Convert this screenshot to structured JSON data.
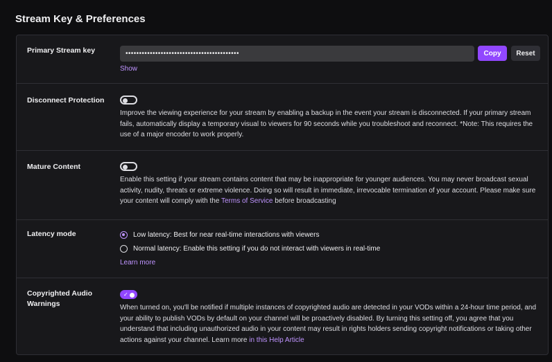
{
  "page": {
    "title": "Stream Key & Preferences"
  },
  "stream_key": {
    "label": "Primary Stream key",
    "masked_value": "••••••••••••••••••••••••••••••••••••••••••",
    "copy_label": "Copy",
    "reset_label": "Reset",
    "show_label": "Show"
  },
  "disconnect_protection": {
    "label": "Disconnect Protection",
    "enabled": false,
    "description": "Improve the viewing experience for your stream by enabling a backup in the event your stream is disconnected. If your primary stream fails, automatically display a temporary visual to viewers for 90 seconds while you troubleshoot and reconnect. *Note: This requires the use of a major encoder to work properly."
  },
  "mature_content": {
    "label": "Mature Content",
    "enabled": false,
    "description_before": "Enable this setting if your stream contains content that may be inappropriate for younger audiences. You may never broadcast sexual activity, nudity, threats or extreme violence. Doing so will result in immediate, irrevocable termination of your account. Please make sure your content will comply with the ",
    "link_label": "Terms of Service",
    "description_after": " before broadcasting"
  },
  "latency_mode": {
    "label": "Latency mode",
    "options": [
      {
        "label": "Low latency: Best for near real-time interactions with viewers",
        "selected": true
      },
      {
        "label": "Normal latency: Enable this setting if you do not interact with viewers in real-time",
        "selected": false
      }
    ],
    "learn_more_label": "Learn more"
  },
  "copyrighted_audio": {
    "label": "Copyrighted Audio Warnings",
    "enabled": true,
    "description_before": "When turned on, you'll be notified if multiple instances of copyrighted audio are detected in your VODs within a 24-hour time period, and your ability to publish VODs by default on your channel will be proactively disabled. By turning this setting off, you agree that you understand that including unauthorized audio in your content may result in rights holders sending copyright notifications or taking other actions against your channel. Learn more ",
    "link_label": "in this Help Article"
  },
  "colors": {
    "accent": "#9147ff",
    "link": "#bf94ff",
    "background": "#0e0e10",
    "panel": "#18181b"
  }
}
